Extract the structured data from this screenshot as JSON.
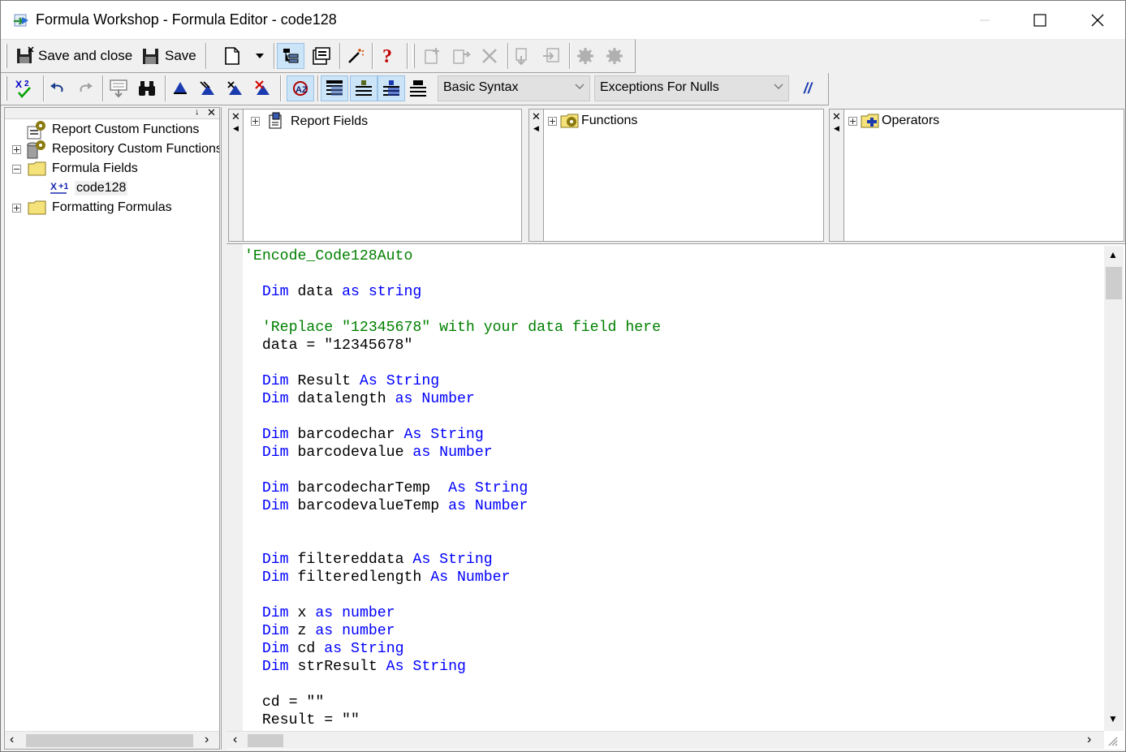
{
  "window": {
    "title": "Formula Workshop - Formula Editor - code128"
  },
  "toolbar1": {
    "save_and_close_label": "Save and close",
    "save_label": "Save"
  },
  "toolbar2": {
    "syntax_selected": "Basic Syntax",
    "null_handling_selected": "Exceptions For Nulls",
    "comment_label": "//"
  },
  "tree": {
    "items": [
      {
        "label": "Report Custom Functions"
      },
      {
        "label": "Repository Custom Functions"
      },
      {
        "label": "Formula Fields"
      },
      {
        "label": "code128"
      },
      {
        "label": "Formatting Formulas"
      }
    ]
  },
  "panels": {
    "report_fields": "Report Fields",
    "functions": "Functions",
    "operators": "Operators"
  },
  "code_lines": [
    [
      {
        "t": "'Encode_Code128Auto",
        "c": "cm"
      }
    ],
    [],
    [
      {
        "t": "  ",
        "c": ""
      },
      {
        "t": "Dim",
        "c": "kw"
      },
      {
        "t": " data ",
        "c": ""
      },
      {
        "t": "as",
        "c": "kw"
      },
      {
        "t": " ",
        "c": ""
      },
      {
        "t": "string",
        "c": "kw"
      }
    ],
    [],
    [
      {
        "t": "  ",
        "c": ""
      },
      {
        "t": "'Replace \"12345678\" with your data field here",
        "c": "cm"
      }
    ],
    [
      {
        "t": "  data = \"12345678\"",
        "c": ""
      }
    ],
    [],
    [
      {
        "t": "  ",
        "c": ""
      },
      {
        "t": "Dim",
        "c": "kw"
      },
      {
        "t": " Result ",
        "c": ""
      },
      {
        "t": "As",
        "c": "kw"
      },
      {
        "t": " ",
        "c": ""
      },
      {
        "t": "String",
        "c": "kw"
      }
    ],
    [
      {
        "t": "  ",
        "c": ""
      },
      {
        "t": "Dim",
        "c": "kw"
      },
      {
        "t": " datalength ",
        "c": ""
      },
      {
        "t": "as",
        "c": "kw"
      },
      {
        "t": " ",
        "c": ""
      },
      {
        "t": "Number",
        "c": "kw"
      }
    ],
    [],
    [
      {
        "t": "  ",
        "c": ""
      },
      {
        "t": "Dim",
        "c": "kw"
      },
      {
        "t": " barcodechar ",
        "c": ""
      },
      {
        "t": "As",
        "c": "kw"
      },
      {
        "t": " ",
        "c": ""
      },
      {
        "t": "String",
        "c": "kw"
      }
    ],
    [
      {
        "t": "  ",
        "c": ""
      },
      {
        "t": "Dim",
        "c": "kw"
      },
      {
        "t": " barcodevalue ",
        "c": ""
      },
      {
        "t": "as",
        "c": "kw"
      },
      {
        "t": " ",
        "c": ""
      },
      {
        "t": "Number",
        "c": "kw"
      }
    ],
    [],
    [
      {
        "t": "  ",
        "c": ""
      },
      {
        "t": "Dim",
        "c": "kw"
      },
      {
        "t": " barcodecharTemp  ",
        "c": ""
      },
      {
        "t": "As",
        "c": "kw"
      },
      {
        "t": " ",
        "c": ""
      },
      {
        "t": "String",
        "c": "kw"
      }
    ],
    [
      {
        "t": "  ",
        "c": ""
      },
      {
        "t": "Dim",
        "c": "kw"
      },
      {
        "t": " barcodevalueTemp ",
        "c": ""
      },
      {
        "t": "as",
        "c": "kw"
      },
      {
        "t": " ",
        "c": ""
      },
      {
        "t": "Number",
        "c": "kw"
      }
    ],
    [],
    [],
    [
      {
        "t": "  ",
        "c": ""
      },
      {
        "t": "Dim",
        "c": "kw"
      },
      {
        "t": " filtereddata ",
        "c": ""
      },
      {
        "t": "As",
        "c": "kw"
      },
      {
        "t": " ",
        "c": ""
      },
      {
        "t": "String",
        "c": "kw"
      }
    ],
    [
      {
        "t": "  ",
        "c": ""
      },
      {
        "t": "Dim",
        "c": "kw"
      },
      {
        "t": " filteredlength ",
        "c": ""
      },
      {
        "t": "As",
        "c": "kw"
      },
      {
        "t": " ",
        "c": ""
      },
      {
        "t": "Number",
        "c": "kw"
      }
    ],
    [],
    [
      {
        "t": "  ",
        "c": ""
      },
      {
        "t": "Dim",
        "c": "kw"
      },
      {
        "t": " x ",
        "c": ""
      },
      {
        "t": "as",
        "c": "kw"
      },
      {
        "t": " ",
        "c": ""
      },
      {
        "t": "number",
        "c": "kw"
      }
    ],
    [
      {
        "t": "  ",
        "c": ""
      },
      {
        "t": "Dim",
        "c": "kw"
      },
      {
        "t": " z ",
        "c": ""
      },
      {
        "t": "as",
        "c": "kw"
      },
      {
        "t": " ",
        "c": ""
      },
      {
        "t": "number",
        "c": "kw"
      }
    ],
    [
      {
        "t": "  ",
        "c": ""
      },
      {
        "t": "Dim",
        "c": "kw"
      },
      {
        "t": " cd ",
        "c": ""
      },
      {
        "t": "as",
        "c": "kw"
      },
      {
        "t": " ",
        "c": ""
      },
      {
        "t": "String",
        "c": "kw"
      }
    ],
    [
      {
        "t": "  ",
        "c": ""
      },
      {
        "t": "Dim",
        "c": "kw"
      },
      {
        "t": " strResult ",
        "c": ""
      },
      {
        "t": "As",
        "c": "kw"
      },
      {
        "t": " ",
        "c": ""
      },
      {
        "t": "String",
        "c": "kw"
      }
    ],
    [],
    [
      {
        "t": "  cd = \"\"",
        "c": ""
      }
    ],
    [
      {
        "t": "  Result = \"\"",
        "c": ""
      }
    ]
  ],
  "colors": {
    "keyword": "#0000ff",
    "comment": "#008000",
    "pressed_button": "#cce4f7"
  }
}
